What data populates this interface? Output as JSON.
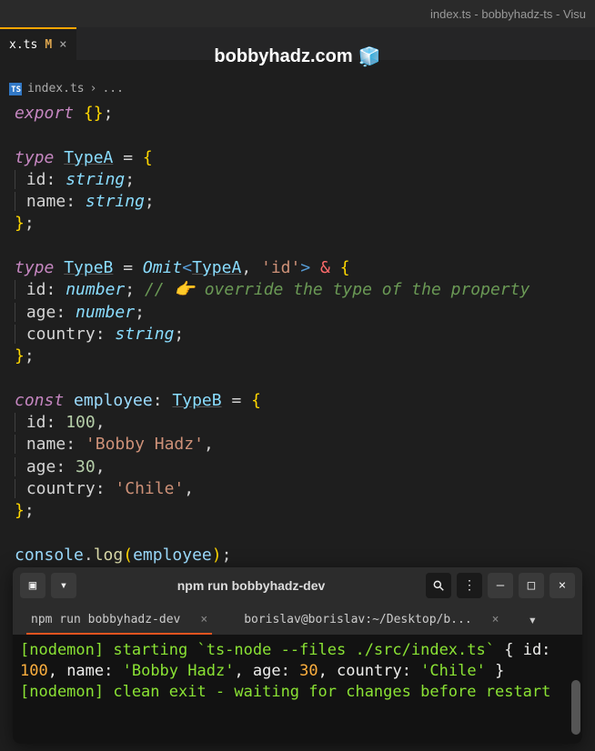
{
  "window_title": "index.ts - bobbyhadz-ts - Visu",
  "tab": {
    "name": "x.ts",
    "modified": "M"
  },
  "url": "bobbyhadz.com",
  "breadcrumb": {
    "file": "index.ts",
    "sep": "›",
    "more": "..."
  },
  "code": {
    "export_kw": "export",
    "type_kw": "type",
    "const_kw": "const",
    "typeA": "TypeA",
    "typeB": "TypeB",
    "omit": "Omit",
    "id": "id",
    "name_prop": "name",
    "age": "age",
    "country": "country",
    "string_t": "string",
    "number_t": "number",
    "id_str": "'id'",
    "comment": "// 👉️ override the type of the property",
    "employee": "employee",
    "val_100": "100",
    "val_bobby": "'Bobby Hadz'",
    "val_30": "30",
    "val_chile": "'Chile'",
    "console": "console",
    "log": "log"
  },
  "terminal": {
    "title": "npm run bobbyhadz-dev",
    "tab1": "npm run bobbyhadz-dev",
    "tab2": "borislav@borislav:~/Desktop/b...",
    "line1_pre": "[nodemon] starting ",
    "line1_cmd": "`ts-node --files ./src/index.ts`",
    "line2_open": "{ id: ",
    "line2_id": "100",
    "line2_name_lbl": ", name: ",
    "line2_name": "'Bobby Hadz'",
    "line2_age_lbl": ", age: ",
    "line2_age": "30",
    "line2_country_lbl": ", country: ",
    "line2_country": "'Chile'",
    "line2_close": " }",
    "line3": "[nodemon] clean exit - waiting for changes before restart"
  }
}
